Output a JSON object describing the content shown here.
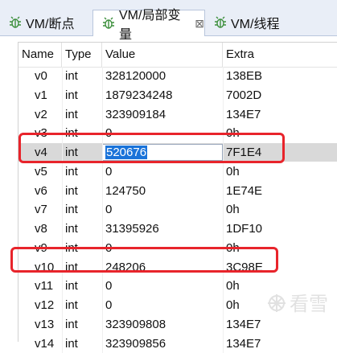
{
  "tabs": [
    {
      "label": "VM/断点",
      "icon": "bug-icon",
      "active": false
    },
    {
      "label": "VM/局部变量",
      "icon": "bug-icon",
      "active": true,
      "close_label": "⊠"
    },
    {
      "label": "VM/线程",
      "icon": "bug-icon",
      "active": false
    }
  ],
  "table": {
    "columns": [
      "Name",
      "Type",
      "Value",
      "Extra"
    ],
    "rows": [
      {
        "name": "v0",
        "type": "int",
        "value": "328120000",
        "extra": "138EB"
      },
      {
        "name": "v1",
        "type": "int",
        "value": "1879234248",
        "extra": "7002D"
      },
      {
        "name": "v2",
        "type": "int",
        "value": "323909184",
        "extra": "134E7"
      },
      {
        "name": "v3",
        "type": "int",
        "value": "0",
        "extra": "0h"
      },
      {
        "name": "v4",
        "type": "int",
        "value": "520676",
        "extra": "7F1E4",
        "selected": true,
        "editing": true
      },
      {
        "name": "v5",
        "type": "int",
        "value": "0",
        "extra": "0h"
      },
      {
        "name": "v6",
        "type": "int",
        "value": "124750",
        "extra": "1E74E"
      },
      {
        "name": "v7",
        "type": "int",
        "value": "0",
        "extra": "0h"
      },
      {
        "name": "v8",
        "type": "int",
        "value": "31395926",
        "extra": "1DF10"
      },
      {
        "name": "v9",
        "type": "int",
        "value": "0",
        "extra": "0h"
      },
      {
        "name": "v10",
        "type": "int",
        "value": "248206",
        "extra": "3C98E"
      },
      {
        "name": "v11",
        "type": "int",
        "value": "0",
        "extra": "0h"
      },
      {
        "name": "v12",
        "type": "int",
        "value": "0",
        "extra": "0h"
      },
      {
        "name": "v13",
        "type": "int",
        "value": "323909808",
        "extra": "134E7"
      },
      {
        "name": "v14",
        "type": "int",
        "value": "323909856",
        "extra": "134E7"
      }
    ]
  },
  "annotations": {
    "highlight_color": "#e8242b",
    "highlighted_rows": [
      "v4",
      "v10"
    ]
  },
  "watermark": {
    "text": "看雪"
  },
  "colors": {
    "selection": "#1a73d9",
    "selected_row": "#d9d9d9",
    "tab_strip": "#e9eef7",
    "icon_green": "#3c8f3c"
  }
}
